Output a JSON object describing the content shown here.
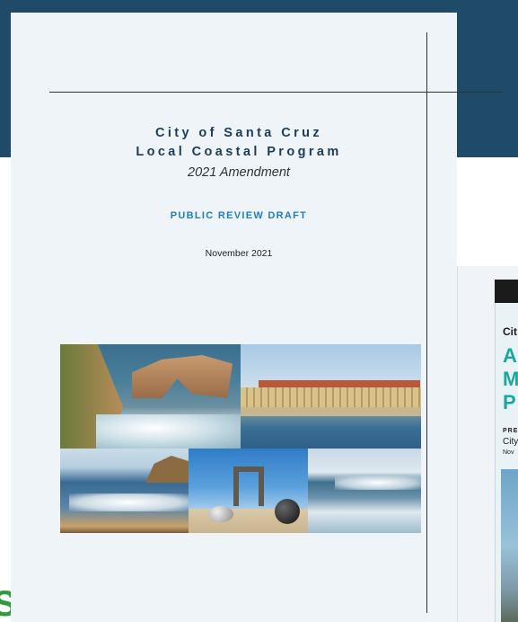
{
  "document": {
    "title_line1": "City of Santa Cruz",
    "title_line2": "Local Coastal Program",
    "subtitle": "2021 Amendment",
    "status": "PUBLIC REVIEW DRAFT",
    "date": "November 2021"
  },
  "background_document": {
    "city_fragment": "Cit",
    "big_letters": [
      "A",
      "M",
      "P"
    ],
    "label_fragment": "PRE",
    "city_line_fragment": "City",
    "date_fragment": "Nov"
  },
  "photos": [
    {
      "name": "rock-arch-photo"
    },
    {
      "name": "boardwalk-photo"
    },
    {
      "name": "coastline-photo"
    },
    {
      "name": "sculpture-photo"
    },
    {
      "name": "surf-wave-photo"
    }
  ],
  "colors": {
    "title": "#1d3c57",
    "draft_label": "#1e7fb8",
    "page_background": "#eff4f8",
    "header_band": "#1f4a68",
    "accent_teal": "#1aa7a0"
  }
}
